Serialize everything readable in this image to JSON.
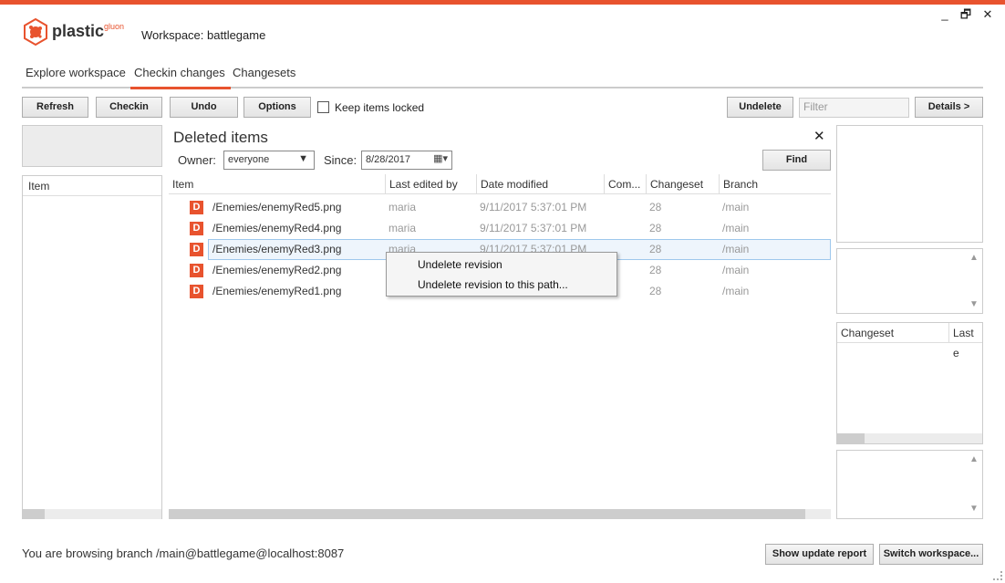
{
  "window": {
    "minimize": "_",
    "restore": "🗗",
    "close": "✕"
  },
  "app": {
    "brand": "plastic",
    "brand_suffix": "gluon",
    "workspace_title": "Workspace: battlegame",
    "accent": "#e8532e"
  },
  "tabs": [
    {
      "label": "Explore workspace"
    },
    {
      "label": "Checkin changes"
    },
    {
      "label": "Changesets"
    }
  ],
  "toolbar": {
    "refresh": "Refresh",
    "checkin": "Checkin",
    "undo": "Undo",
    "options": "Options",
    "keep_locked": "Keep items locked",
    "undelete": "Undelete",
    "filter_placeholder": "Filter",
    "details": "Details >"
  },
  "left_panel": {
    "header": "Item"
  },
  "deleted": {
    "title": "Deleted items",
    "close": "✕",
    "owner_label": "Owner:",
    "owner_value": "everyone",
    "since_label": "Since:",
    "since_value": "8/28/2017",
    "find": "Find",
    "columns": [
      "Item",
      "Last edited by",
      "Date modified",
      "Com...",
      "Changeset",
      "Branch"
    ],
    "rows": [
      {
        "icon": "D",
        "item": "/Enemies/enemyRed5.png",
        "user": "maria",
        "date": "9/11/2017 5:37:01 PM",
        "changeset": "28",
        "branch": "/main"
      },
      {
        "icon": "D",
        "item": "/Enemies/enemyRed4.png",
        "user": "maria",
        "date": "9/11/2017 5:37:01 PM",
        "changeset": "28",
        "branch": "/main"
      },
      {
        "icon": "D",
        "item": "/Enemies/enemyRed3.png",
        "user": "maria",
        "date": "9/11/2017 5:37:01 PM",
        "changeset": "28",
        "branch": "/main"
      },
      {
        "icon": "D",
        "item": "/Enemies/enemyRed2.png",
        "user": "",
        "date": "",
        "changeset": "28",
        "branch": "/main"
      },
      {
        "icon": "D",
        "item": "/Enemies/enemyRed1.png",
        "user": "",
        "date": "",
        "changeset": "28",
        "branch": "/main"
      }
    ]
  },
  "context_menu": {
    "items": [
      "Undelete revision",
      "Undelete revision to this path..."
    ]
  },
  "right_panel": {
    "changeset_header": "Changeset",
    "last_header": "Last e",
    "scroll_up": "▲",
    "scroll_down": "▼"
  },
  "status": {
    "text": "You are browsing branch /main@battlegame@localhost:8087",
    "show_update": "Show update report",
    "switch_ws": "Switch workspace..."
  }
}
